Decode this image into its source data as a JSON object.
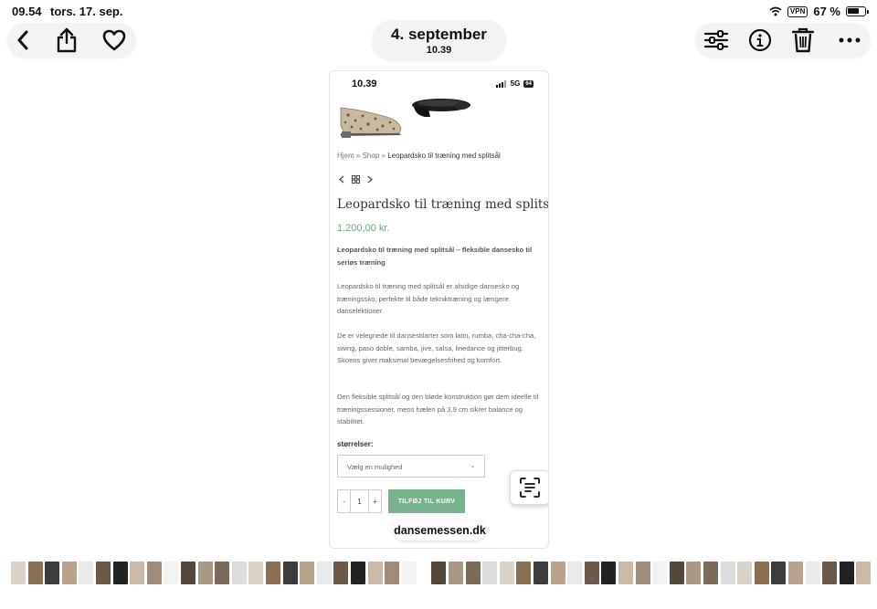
{
  "status_bar": {
    "time": "09.54",
    "date": "tors. 17. sep.",
    "vpn": "VPN",
    "battery": "67 %"
  },
  "header": {
    "title": "4. september",
    "subtitle": "10.39"
  },
  "icons": {
    "left": [
      "back-icon",
      "share-icon",
      "heart-icon"
    ],
    "right": [
      "adjust-icon",
      "info-icon",
      "trash-icon",
      "more-icon"
    ]
  },
  "screenshot": {
    "status": {
      "time": "10.39",
      "network": "5G",
      "battery": "64"
    },
    "breadcrumb": {
      "home": "Hjem",
      "sep": "»",
      "shop": "Shop",
      "current": "Leopardsko til træning med splitsål"
    },
    "product": {
      "title": "Leopardsko til træning med splitsål",
      "price": "1.200,00 kr.",
      "intro": "Leopardsko til træning med splitsål – fleksible dansesko til seriøs træning",
      "p1": "Leopardsko til træning med splitsål er alsidige dansesko og træningssko, perfekte til både tekniktræning og længere danselektioner.",
      "p2": "De er velegnede til dansestilarter som latin, rumba, cha-cha-cha, swing, paso doble, samba, jive, salsa, linedance og jitterbug. Skoens giver maksimal bevægelsesfrihed og komfort.",
      "p3": "Den fleksible splitsål og den bløde konstruktion gør dem ideelle til træningssessioner, mens hælen på 3,9 cm sikrer balance og stabilitet.",
      "size_label": "størrelser:",
      "select_placeholder": "Vælg en mulighed",
      "qty_minus": "-",
      "qty_value": "1",
      "qty_plus": "+",
      "add_to_cart": "TILFØJ TIL KURV"
    },
    "domain": "dansemessen.dk"
  },
  "colors": {
    "price": "#6aa87e",
    "button": "#77b38c"
  }
}
